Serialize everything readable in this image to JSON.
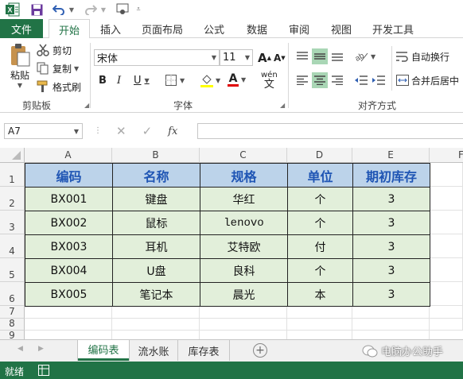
{
  "quick_access": {
    "icons": [
      "excel-logo-icon",
      "save-icon",
      "undo-icon",
      "redo-icon",
      "touch-mode-icon",
      "customize-qat-icon"
    ]
  },
  "tabs": [
    {
      "label": "文件",
      "active": false
    },
    {
      "label": "开始",
      "active": true
    },
    {
      "label": "插入",
      "active": false
    },
    {
      "label": "页面布局",
      "active": false
    },
    {
      "label": "公式",
      "active": false
    },
    {
      "label": "数据",
      "active": false
    },
    {
      "label": "审阅",
      "active": false
    },
    {
      "label": "视图",
      "active": false
    },
    {
      "label": "开发工具",
      "active": false
    }
  ],
  "clipboard": {
    "paste": "粘贴",
    "cut": "剪切",
    "copy": "复制",
    "format_painter": "格式刷",
    "label": "剪贴板"
  },
  "font": {
    "name": "宋体",
    "size": "11",
    "label": "字体",
    "bold": "B",
    "italic": "I",
    "underline": "U",
    "grow": "A",
    "shrink": "A",
    "font_color": "A",
    "phonetic": "wén"
  },
  "alignment": {
    "wrap": "自动换行",
    "merge": "合并后居中",
    "label": "对齐方式"
  },
  "formula_bar": {
    "name_box": "A7",
    "fx": "fx",
    "value": ""
  },
  "columns": [
    "A",
    "B",
    "C",
    "D",
    "E",
    "F"
  ],
  "rows": [
    "1",
    "2",
    "3",
    "4",
    "5",
    "6",
    "7",
    "8",
    "9"
  ],
  "table": {
    "headers": [
      "编码",
      "名称",
      "规格",
      "单位",
      "期初库存"
    ],
    "rows": [
      [
        "BX001",
        "键盘",
        "华红",
        "个",
        "3"
      ],
      [
        "BX002",
        "鼠标",
        "lenovo",
        "个",
        "3"
      ],
      [
        "BX003",
        "耳机",
        "艾特欧",
        "付",
        "3"
      ],
      [
        "BX004",
        "U盘",
        "良科",
        "个",
        "3"
      ],
      [
        "BX005",
        "笔记本",
        "晨光",
        "本",
        "3"
      ]
    ]
  },
  "sheets": [
    {
      "label": "编码表",
      "active": true
    },
    {
      "label": "流水账",
      "active": false
    },
    {
      "label": "库存表",
      "active": false
    }
  ],
  "watermark": "电脑办公助手",
  "status": {
    "ready": "就绪"
  },
  "colors": {
    "excel_green": "#217346",
    "header_fill": "#bcd3ea",
    "header_text": "#1f55b4",
    "data_fill": "#e2efda"
  }
}
